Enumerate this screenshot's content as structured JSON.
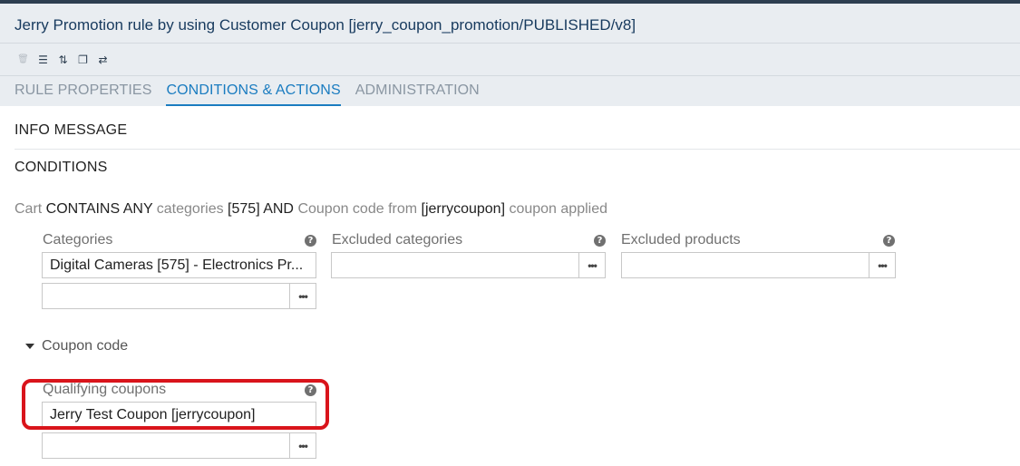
{
  "header": {
    "title": "Jerry Promotion rule by using Customer Coupon [jerry_coupon_promotion/PUBLISHED/v8]",
    "toolbar": [
      {
        "icon": "trash-icon",
        "glyph": "🗑"
      },
      {
        "icon": "database-icon",
        "glyph": "☰"
      },
      {
        "icon": "sync-icon",
        "glyph": "⇅"
      },
      {
        "icon": "copy-icon",
        "glyph": "❐"
      },
      {
        "icon": "compare-icon",
        "glyph": "⇄"
      }
    ]
  },
  "tabs": [
    {
      "label": "RULE PROPERTIES",
      "active": false
    },
    {
      "label": "CONDITIONS & ACTIONS",
      "active": true
    },
    {
      "label": "ADMINISTRATION",
      "active": false
    }
  ],
  "sections": {
    "info_message": "INFO MESSAGE",
    "conditions": "CONDITIONS"
  },
  "summary": {
    "p1": "Cart ",
    "p2": "CONTAINS ANY",
    "p3": " categories ",
    "p4": "[575]",
    "p5": "  AND  ",
    "p6": "Coupon code from ",
    "p7": "[jerrycoupon]",
    "p8": " coupon applied"
  },
  "fields": {
    "categories": {
      "label": "Categories",
      "value": "Digital Cameras [575] - Electronics Pr...",
      "new_value": ""
    },
    "excluded_categories": {
      "label": "Excluded categories",
      "value": ""
    },
    "excluded_products": {
      "label": "Excluded products",
      "value": ""
    },
    "coupon_code_section": "Coupon code",
    "qualifying_coupons": {
      "label": "Qualifying coupons",
      "value": "Jerry Test Coupon [jerrycoupon]",
      "new_value": ""
    }
  },
  "icons": {
    "help": "?",
    "picker": "•••"
  },
  "colors": {
    "accent": "#1a7cc0",
    "highlight": "#d9141b",
    "header_bg": "#e9edf1"
  }
}
